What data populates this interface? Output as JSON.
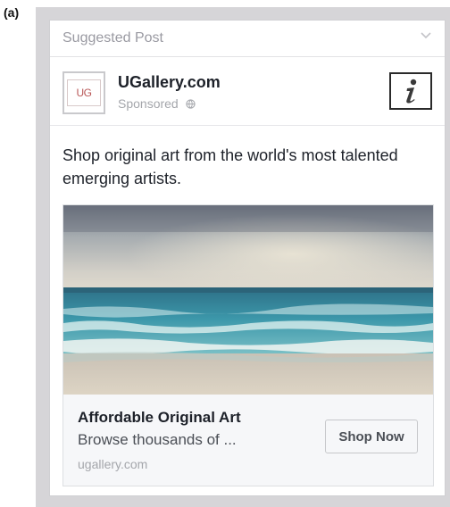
{
  "figure_label": "(a)",
  "suggested_post": {
    "label": "Suggested Post",
    "menu_icon": "chevron-down-icon"
  },
  "advertiser": {
    "logo_text": "UG",
    "name": "UGallery.com",
    "sponsored_label": "Sponsored",
    "privacy_icon": "globe-icon",
    "info_icon": "info-icon"
  },
  "post": {
    "text": "Shop original art from the world's most talented emerging artists."
  },
  "ad": {
    "image_icon": "seascape-painting-image",
    "headline": "Affordable Original Art",
    "description": "Browse thousands of ...",
    "domain": "ugallery.com",
    "cta_label": "Shop Now"
  },
  "colors": {
    "frame": "#d6d5d8",
    "card": "#ffffff",
    "name_text": "#1d2129",
    "muted_text": "#a4a6ab",
    "footer_bg": "#f6f7f9"
  }
}
